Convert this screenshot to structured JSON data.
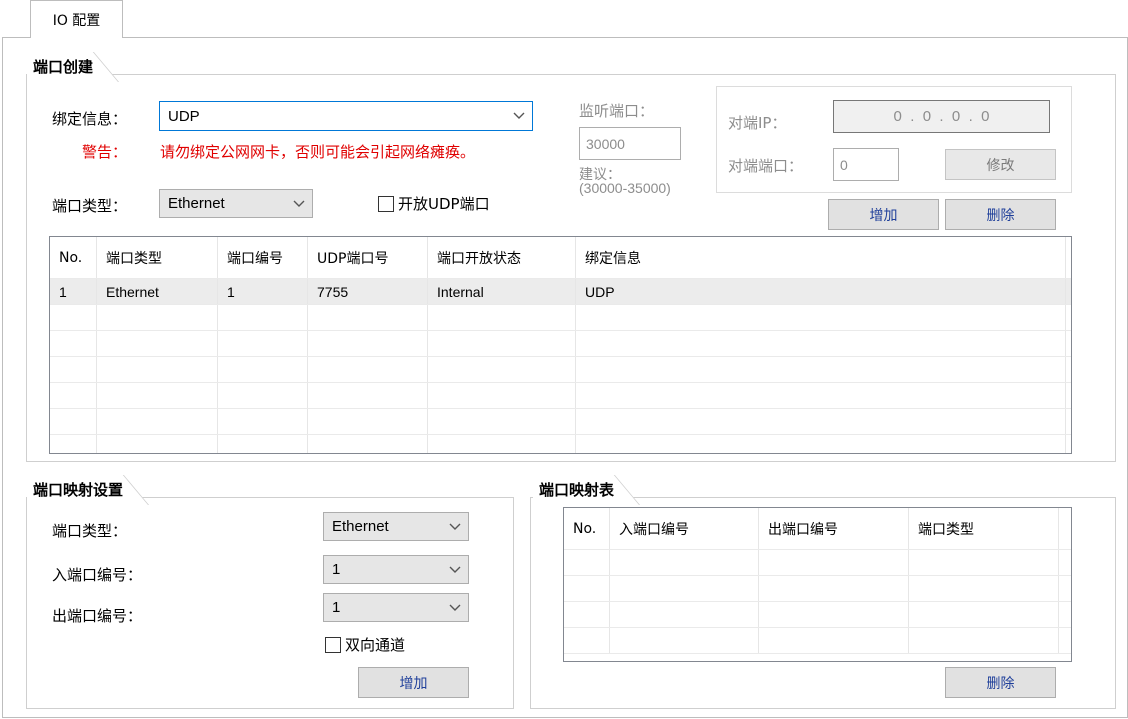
{
  "tab": {
    "label": "IO 配置"
  },
  "port_create": {
    "title": "端口创建",
    "bind_label": "绑定信息：",
    "bind_value": "UDP",
    "warning_label": "警告：",
    "warning_text": "请勿绑定公网网卡，否则可能会引起网络瘫痪。",
    "port_type_label": "端口类型：",
    "port_type_value": "Ethernet",
    "open_udp_label": "开放UDP端口",
    "listen_label": "监听端口：",
    "listen_value": "30000",
    "suggest_label": "建议：",
    "suggest_range": "(30000-35000)",
    "peer_ip_label": "对端IP：",
    "peer_ip_value": "0  .  0  .  0  .  0",
    "peer_port_label": "对端端口：",
    "peer_port_value": "0",
    "modify_button": "修改",
    "add_button": "增加",
    "delete_button": "删除",
    "table": {
      "columns": [
        "No.",
        "端口类型",
        "端口编号",
        "UDP端口号",
        "端口开放状态",
        "绑定信息"
      ],
      "rows": [
        [
          "1",
          "Ethernet",
          "1",
          "7755",
          "Internal",
          "UDP"
        ]
      ]
    }
  },
  "mapping_settings": {
    "title": "端口映射设置",
    "port_type_label": "端口类型：",
    "port_type_value": "Ethernet",
    "in_port_label": "入端口编号：",
    "in_port_value": "1",
    "out_port_label": "出端口编号：",
    "out_port_value": "1",
    "bidirectional_label": "双向通道",
    "add_button": "增加"
  },
  "mapping_table": {
    "title": "端口映射表",
    "columns": [
      "No.",
      "入端口编号",
      "出端口编号",
      "端口类型"
    ],
    "delete_button": "删除"
  },
  "icons": {
    "dropdown": "chevron-down-icon",
    "checkbox": "checkbox-unchecked-icon"
  },
  "colors": {
    "warning": "#e00000",
    "button_text": "#1f3f9a",
    "disabled_text": "#8d8d8d",
    "focus_border": "#0078d7"
  }
}
